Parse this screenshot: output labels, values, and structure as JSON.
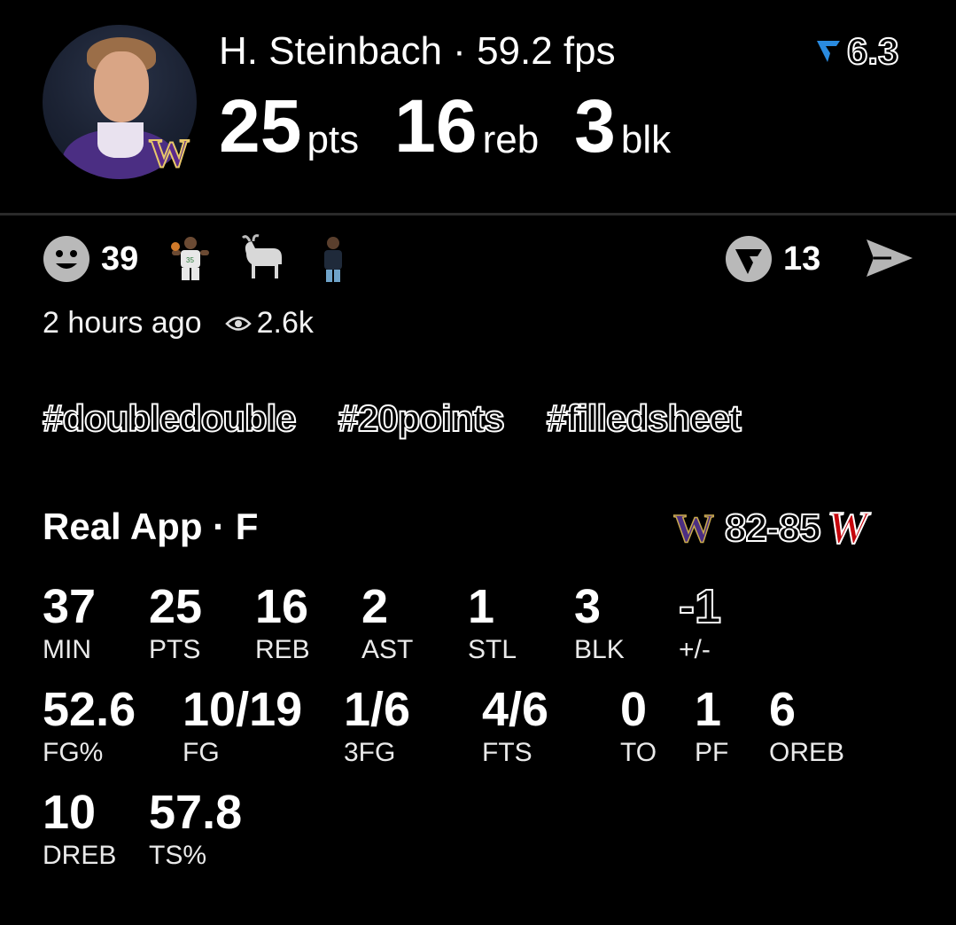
{
  "header": {
    "player_name": "H. Steinbach",
    "fantasy_points": "59.2 fps",
    "rating": "6.3",
    "team_logo": "W",
    "headline_stats": [
      {
        "value": "25",
        "unit": "pts"
      },
      {
        "value": "16",
        "unit": "reb"
      },
      {
        "value": "3",
        "unit": "blk"
      }
    ]
  },
  "reactions": {
    "smiley_count": "39",
    "emojis": [
      "player-emoji",
      "goat-emoji",
      "person-emoji"
    ],
    "vote_count": "13"
  },
  "meta": {
    "time_ago": "2 hours ago",
    "views": "2.6k"
  },
  "hashtags": [
    "#doubledouble",
    "#20points",
    "#filledsheet"
  ],
  "game": {
    "title": "Real App · F",
    "home_logo": "W",
    "score": "82-85",
    "away_logo": "W"
  },
  "box_score": [
    [
      {
        "value": "37",
        "label": "MIN"
      },
      {
        "value": "25",
        "label": "PTS"
      },
      {
        "value": "16",
        "label": "REB"
      },
      {
        "value": "2",
        "label": "AST"
      },
      {
        "value": "1",
        "label": "STL"
      },
      {
        "value": "3",
        "label": "BLK"
      },
      {
        "value": "-1",
        "label": "+/-"
      }
    ],
    [
      {
        "value": "52.6",
        "label": "FG%"
      },
      {
        "value": "10/19",
        "label": "FG"
      },
      {
        "value": "1/6",
        "label": "3FG"
      },
      {
        "value": "4/6",
        "label": "FTS"
      },
      {
        "value": "0",
        "label": "TO"
      },
      {
        "value": "1",
        "label": "PF"
      },
      {
        "value": "6",
        "label": "OREB"
      }
    ],
    [
      {
        "value": "10",
        "label": "DREB"
      },
      {
        "value": "57.8",
        "label": "TS%"
      }
    ]
  ],
  "colors": {
    "background": "#000000",
    "text": "#ffffff",
    "uw_purple": "#4b2e83",
    "wisconsin_red": "#c5050c",
    "rating_blue": "#2a8be0"
  }
}
